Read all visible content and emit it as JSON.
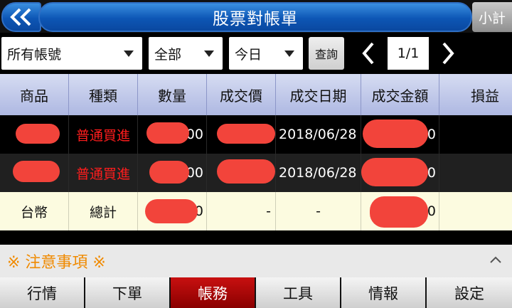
{
  "header": {
    "title": "股票對帳單",
    "subtotal_label": "小計",
    "back_icon": "double-chevron-left-icon"
  },
  "filters": {
    "account": "所有帳號",
    "category": "全部",
    "period": "今日",
    "query_label": "查詢",
    "page": "1/1"
  },
  "table": {
    "columns": [
      "商品",
      "種類",
      "數量",
      "成交價",
      "成交日期",
      "成交金額",
      "損益"
    ],
    "rows": [
      {
        "type": "普通買進",
        "qty_tail": "00",
        "date": "2018/06/28",
        "amount_tail": "0"
      },
      {
        "type": "普通買進",
        "qty_tail": "00",
        "date": "2018/06/28",
        "amount_tail": "0"
      }
    ],
    "total": {
      "product": "台幣",
      "type": "總計",
      "qty_tail": "0",
      "price": "-",
      "date": "-",
      "amount_tail": "0"
    }
  },
  "notice": {
    "label": "※ 注意事項 ※"
  },
  "tabs": [
    {
      "label": "行情",
      "active": false
    },
    {
      "label": "下單",
      "active": false
    },
    {
      "label": "帳務",
      "active": true
    },
    {
      "label": "工具",
      "active": false
    },
    {
      "label": "情報",
      "active": false
    },
    {
      "label": "設定",
      "active": false
    }
  ],
  "colors": {
    "accent_blue": "#0d56b5",
    "active_tab": "#b00000",
    "notice_text": "#f08a00",
    "buy_text": "#ff1d1d",
    "redaction": "#f2443b"
  }
}
